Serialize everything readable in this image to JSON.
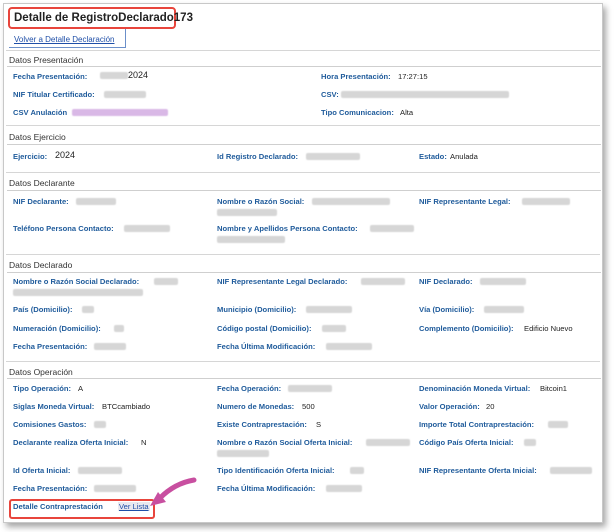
{
  "title": "Detalle de RegistroDeclarado173",
  "back_link": "Volver a Detalle Declaración",
  "sections": {
    "presentacion": "Datos Presentación",
    "ejercicio": "Datos Ejercicio",
    "declarante": "Datos Declarante",
    "declarado": "Datos Declarado",
    "operacion": "Datos Operación"
  },
  "presentacion": {
    "fecha_presentacion_label": "Fecha Presentación:",
    "fecha_presentacion_value": "2024",
    "hora_presentacion_label": "Hora Presentación:",
    "hora_presentacion_value": "17:27:15",
    "nif_titular_label": "NIF Titular Certificado:",
    "csv_label": "CSV:",
    "csv_anulacion_label": "CSV Anulación",
    "tipo_comunicacion_label": "Tipo Comunicacion:",
    "tipo_comunicacion_value": "Alta"
  },
  "ejercicio": {
    "ejercicio_label": "Ejercicio:",
    "ejercicio_value": "2024",
    "id_registro_label": "Id Registro Declarado:",
    "estado_label": "Estado:",
    "estado_value": "Anulada"
  },
  "declarante": {
    "nif_label": "NIF Declarante:",
    "nombre_label": "Nombre o Razón Social:",
    "nif_representante_label": "NIF Representante Legal:",
    "telefono_label": "Teléfono Persona Contacto:",
    "nombre_contacto_label": "Nombre y Apellidos Persona Contacto:"
  },
  "declarado": {
    "nombre_label": "Nombre o Razón Social Declarado:",
    "nif_rep_label": "NIF Representante Legal Declarado:",
    "nif_label": "NIF Declarado:",
    "pais_label": "País (Domicilio):",
    "municipio_label": "Municipio (Domicilio):",
    "via_label": "Vía (Domicilio):",
    "numeracion_label": "Numeración (Domicilio):",
    "codigo_postal_label": "Código postal (Domicilio):",
    "complemento_label": "Complemento (Domicilio):",
    "complemento_value": "Edificio Nuevo",
    "fecha_presentacion_label": "Fecha Presentación:",
    "fecha_modificacion_label": "Fecha Última Modificación:"
  },
  "operacion": {
    "tipo_label": "Tipo Operación:",
    "tipo_value": "A",
    "fecha_label": "Fecha Operación:",
    "denominacion_label": "Denominación Moneda Virtual:",
    "denominacion_value": "Bitcoin1",
    "siglas_label": "Siglas Moneda Virtual:",
    "siglas_value": "BTCcambiado",
    "numero_label": "Numero de Monedas:",
    "numero_value": "500",
    "valor_label": "Valor Operación:",
    "valor_value": "20",
    "comisiones_label": "Comisiones Gastos:",
    "existe_label": "Existe Contraprestación:",
    "existe_value": "S",
    "importe_label": "Importe Total Contraprestación:",
    "oferta_label": "Declarante realiza Oferta Inicial:",
    "oferta_value": "N",
    "nombre_oferta_label": "Nombre o Razón Social Oferta Inicial:",
    "codigo_pais_label": "Código País Oferta Inicial:",
    "id_oferta_label": "Id Oferta Inicial:",
    "tipo_ident_label": "Tipo Identificación Oferta Inicial:",
    "nif_rep_oferta_label": "NIF Representante Oferta Inicial:",
    "fecha_presentacion_label": "Fecha Presentación:",
    "fecha_modificacion_label": "Fecha Última Modificación:",
    "detalle_label": "Detalle Contraprestación",
    "ver_lista": "Ver Lista"
  },
  "colors": {
    "label": "#1f5b9b",
    "link": "#1f4fa8",
    "highlight": "#e8453c",
    "arrow": "#c84fa0"
  }
}
